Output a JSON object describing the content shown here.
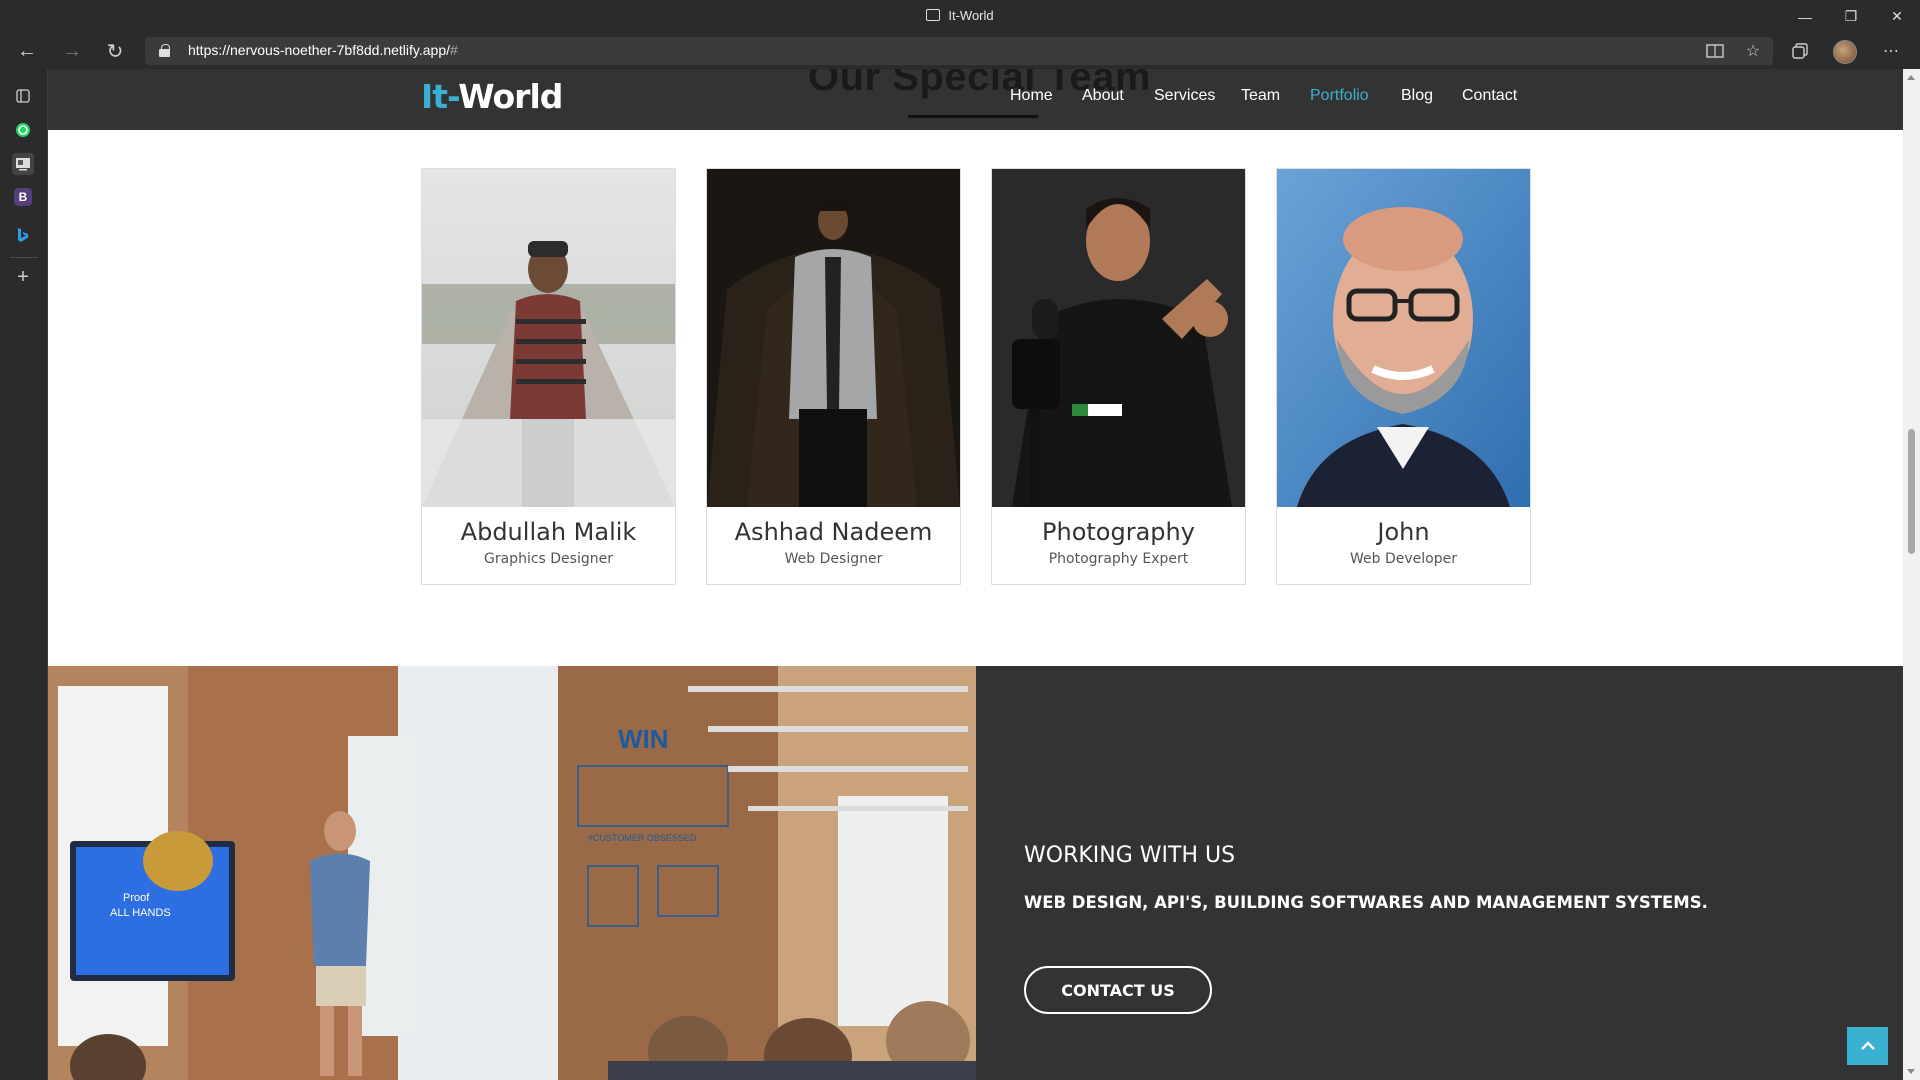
{
  "browser": {
    "window_title": "It-World",
    "url_host": "https://nervous-noether-7bf8dd.netlify.app/",
    "url_rest": "#"
  },
  "sidebar": {
    "items": [
      "tabs-icon",
      "whatsapp-icon",
      "reader-icon",
      "bootstrap-icon",
      "bing-icon",
      "add-icon"
    ],
    "bootstrap_letter": "B"
  },
  "site": {
    "section_title": "Our Special Team",
    "logo_accent": "It-",
    "logo_main": "World",
    "accent_color": "#3ab0d0",
    "nav": [
      "Home",
      "About",
      "Services",
      "Team",
      "Portfolio",
      "Blog",
      "Contact"
    ],
    "active_nav": "Portfolio"
  },
  "team": [
    {
      "name": "Abdullah Malik",
      "role": "Graphics Designer"
    },
    {
      "name": "Ashhad Nadeem",
      "role": "Web Designer"
    },
    {
      "name": "Photography",
      "role": "Photography Expert"
    },
    {
      "name": "John",
      "role": "Web Developer"
    }
  ],
  "work": {
    "heading": "WORKING WITH US",
    "subheading": "WEB DESIGN, API'S, BUILDING SOFTWARES AND MANAGEMENT SYSTEMS.",
    "button": "CONTACT US",
    "poster_win": "WIN",
    "screen_text_1": "Proof",
    "screen_text_2": "ALL HANDS",
    "wall_text": "#CUSTOMER OBSESSED"
  }
}
